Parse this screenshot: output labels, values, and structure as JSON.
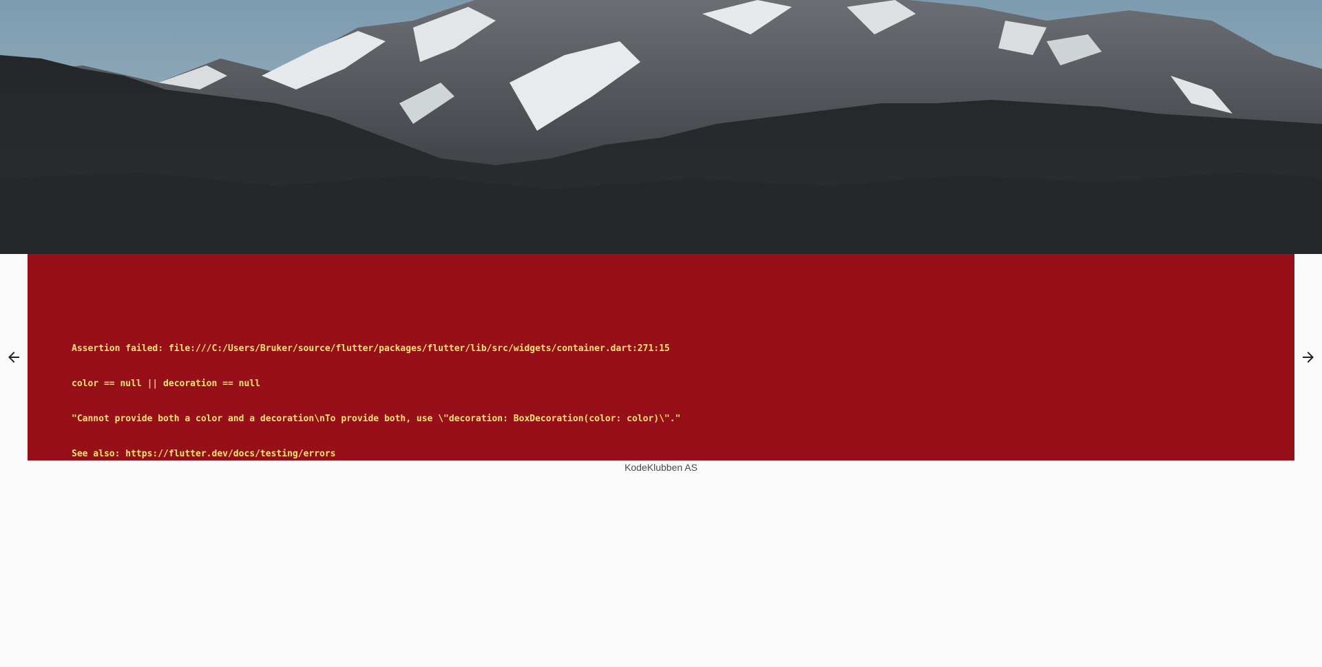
{
  "hero": {
    "image_icon": "mountain-landscape-image"
  },
  "error": {
    "lines": [
      "Assertion failed: file:///C:/Users/Bruker/source/flutter/packages/flutter/lib/src/widgets/container.dart:271:15",
      "color == null || decoration == null",
      "\"Cannot provide both a color and a decoration\\nTo provide both, use \\\"decoration: BoxDecoration(color: color)\\\".\"",
      "See also: https://flutter.dev/docs/testing/errors"
    ],
    "background_color": "#970f18",
    "text_color": "#f3e676"
  },
  "navigation": {
    "prev_icon": "arrow-left-icon",
    "next_icon": "arrow-right-icon"
  },
  "caption": {
    "text": "KodeKlubben AS"
  }
}
